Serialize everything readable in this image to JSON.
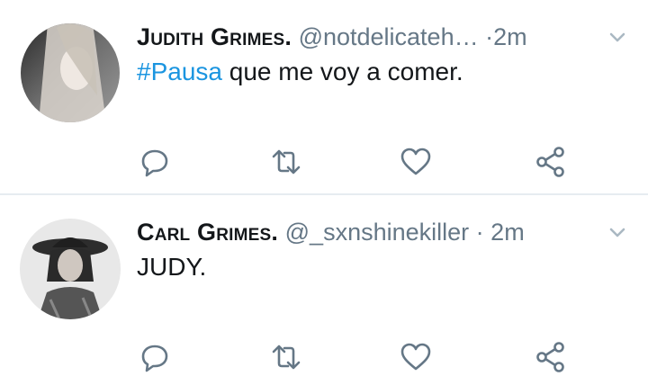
{
  "tweets": [
    {
      "name": "Judith Grimes.",
      "handle": "@notdelicateh…",
      "separator": "·",
      "time": "2m",
      "hashtag": "#Pausa",
      "text": " que me voy a comer."
    },
    {
      "name": "Carl Grimes.",
      "handle": "@_sxnshinekiller",
      "separator": "·",
      "time": "2m",
      "hashtag": "",
      "text": "JUDY."
    }
  ],
  "icons": [
    "reply-icon",
    "retweet-icon",
    "like-icon",
    "share-icon",
    "caret-down-icon"
  ],
  "colors": {
    "icon": "#657786",
    "hashtag": "#1b95e0",
    "divider": "#e6ecf0"
  }
}
